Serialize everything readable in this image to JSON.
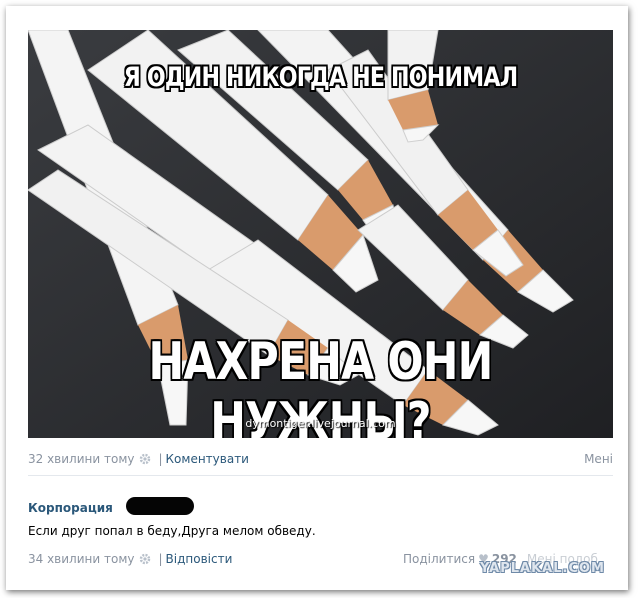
{
  "post": {
    "image": {
      "top_caption": "Я ОДИН НИКОГДА НЕ ПОНИМАЛ",
      "bottom_caption": "НАХРЕНА ОНИ НУЖНЫ?",
      "watermark_url": "dymontiger.livejournal.com"
    },
    "time": "32 хвилини тому",
    "separator": "|",
    "comment_link": "Коментувати",
    "more_label": "Мені"
  },
  "reply": {
    "author": "Корпорация",
    "text": "Если друг попал в беду,Друга мелом обведу.",
    "time": "34 хвилини тому",
    "separator": "|",
    "reply_link": "Відповісти",
    "share_label": "Поділитися",
    "like_count": "292",
    "like_tail": "Мені подоб"
  },
  "site_watermark": "YAPLAKAL.COM",
  "colors": {
    "link": "#2b587a",
    "meta": "#8a93a0",
    "meme_background": "#2c2e31",
    "pencil_wood": "#d99b6c"
  },
  "icons": [
    "gear-icon",
    "heart-icon"
  ]
}
